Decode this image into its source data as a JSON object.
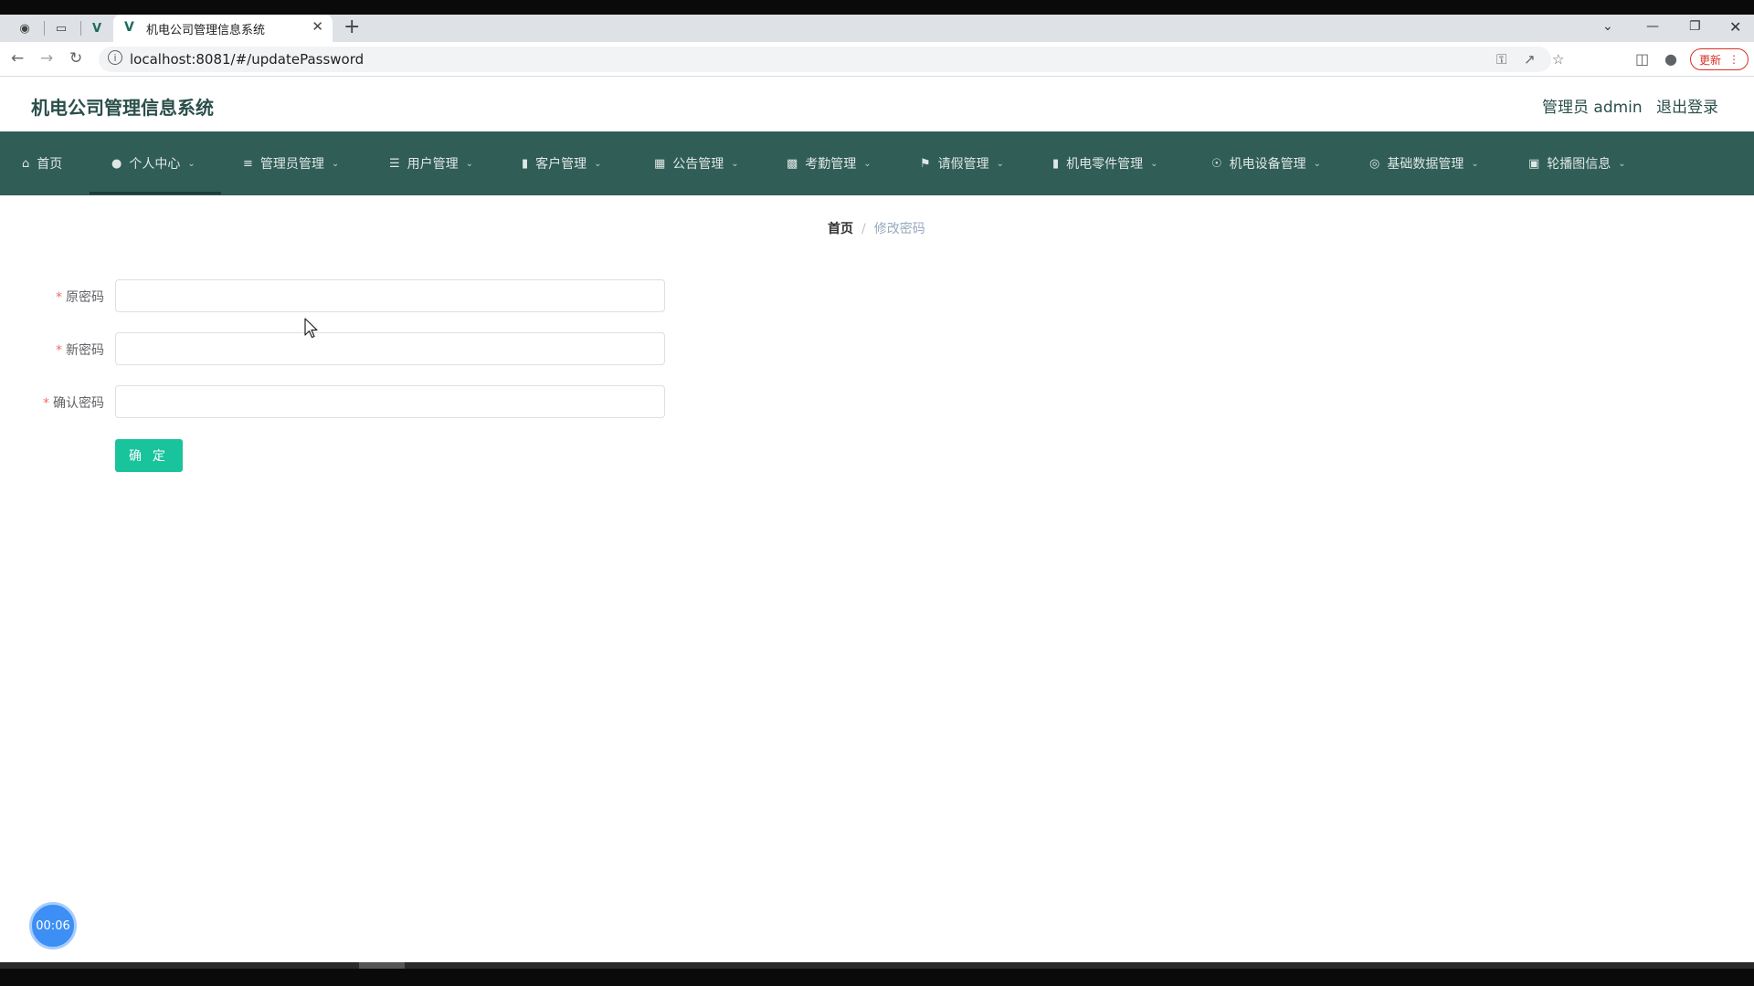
{
  "browser": {
    "tab_title": "机电公司管理信息系统",
    "url": "localhost:8081/#/updatePassword",
    "update_label": "更新"
  },
  "header": {
    "title": "机电公司管理信息系统",
    "user": "管理员 admin",
    "logout": "退出登录"
  },
  "nav": {
    "items": [
      {
        "label": "首页",
        "icon": "home-icon"
      },
      {
        "label": "个人中心",
        "icon": "user-icon"
      },
      {
        "label": "管理员管理",
        "icon": "sliders-icon"
      },
      {
        "label": "用户管理",
        "icon": "list-icon"
      },
      {
        "label": "客户管理",
        "icon": "bar-chart-icon"
      },
      {
        "label": "公告管理",
        "icon": "grid-icon"
      },
      {
        "label": "考勤管理",
        "icon": "briefcase-icon"
      },
      {
        "label": "请假管理",
        "icon": "flag-icon"
      },
      {
        "label": "机电零件管理",
        "icon": "bookmark-icon"
      },
      {
        "label": "机电设备管理",
        "icon": "microphone-icon"
      },
      {
        "label": "基础数据管理",
        "icon": "globe-icon"
      },
      {
        "label": "轮播图信息",
        "icon": "chart-icon"
      }
    ]
  },
  "breadcrumb": {
    "home": "首页",
    "current": "修改密码"
  },
  "form": {
    "old_password_label": "原密码",
    "new_password_label": "新密码",
    "confirm_password_label": "确认密码",
    "submit_label": "确 定"
  },
  "timer": "00:06"
}
